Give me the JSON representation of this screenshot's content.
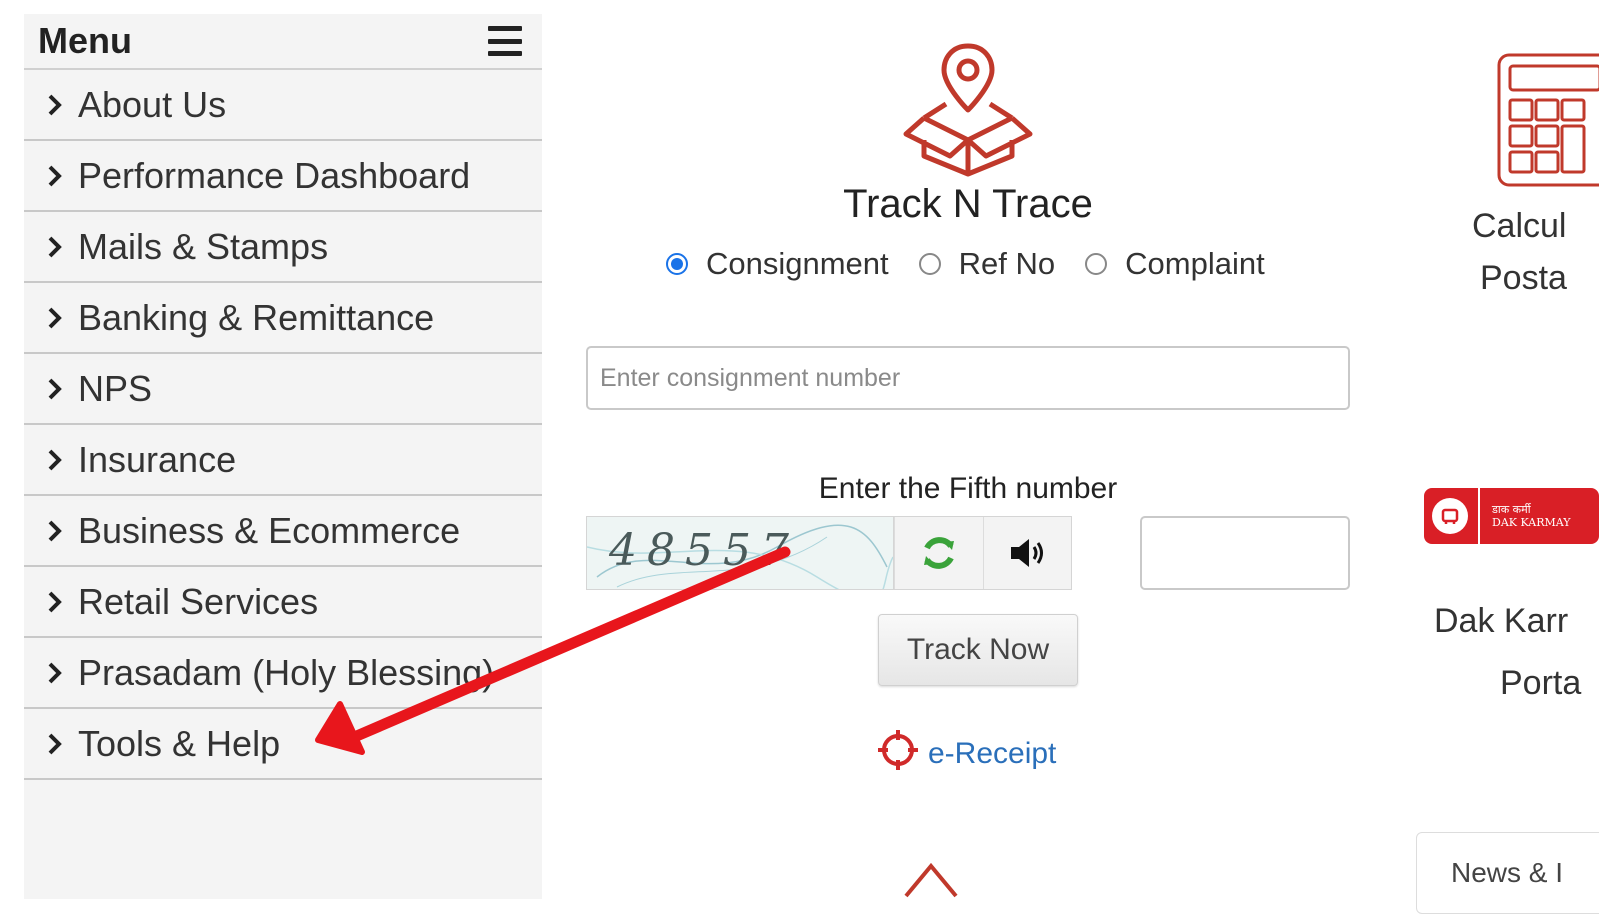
{
  "sidebar": {
    "title": "Menu",
    "items": [
      {
        "label": "About Us"
      },
      {
        "label": "Performance Dashboard"
      },
      {
        "label": "Mails & Stamps"
      },
      {
        "label": "Banking & Remittance"
      },
      {
        "label": "NPS"
      },
      {
        "label": "Insurance"
      },
      {
        "label": "Business & Ecommerce"
      },
      {
        "label": "Retail Services"
      },
      {
        "label": "Prasadam (Holy Blessing)"
      },
      {
        "label": "Tools & Help"
      }
    ]
  },
  "track": {
    "icon": "parcel-location-icon",
    "title": "Track N Trace",
    "radios": [
      {
        "label": "Consignment",
        "selected": true
      },
      {
        "label": "Ref No",
        "selected": false
      },
      {
        "label": "Complaint",
        "selected": false
      }
    ],
    "input_placeholder": "Enter consignment number",
    "captcha_label": "Enter the Fifth number",
    "captcha_text": "48557",
    "button_label": "Track Now",
    "ereceipt_label": "e-Receipt"
  },
  "right": {
    "calc_line1": "Calcul",
    "calc_line2": "Posta",
    "dak_line1": "Dak Karr",
    "dak_line2": "Porta",
    "dak_badge_line1": "डाक कर्मी",
    "dak_badge_line2": "DAK KARMAY",
    "news_label": "News & I"
  },
  "colors": {
    "accent": "#1a73e8",
    "brand_red": "#d91f26",
    "icon_red": "#c0392b",
    "link_blue": "#2a6fba",
    "annotation_arrow": "#e8161c"
  }
}
